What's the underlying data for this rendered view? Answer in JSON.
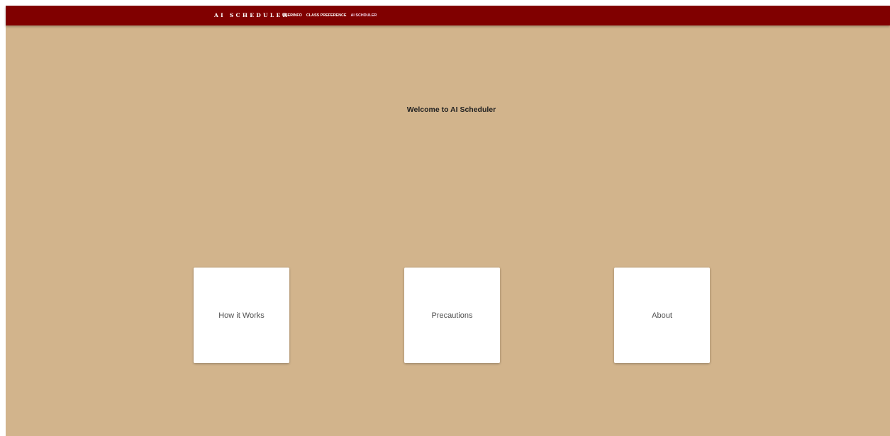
{
  "navbar": {
    "brand": "AI SCHEDULER",
    "links": [
      {
        "label": "USERINFO"
      },
      {
        "label": "CLASS PREFERENCE"
      },
      {
        "label": "AI SCHDULER"
      }
    ]
  },
  "main": {
    "welcome": "Welcome to AI Scheduler",
    "cards": [
      {
        "label": "How it Works"
      },
      {
        "label": "Precautions"
      },
      {
        "label": "About"
      }
    ]
  },
  "colors": {
    "navbar_bg": "#800000",
    "page_bg": "#d2b48c",
    "card_bg": "#ffffff"
  }
}
